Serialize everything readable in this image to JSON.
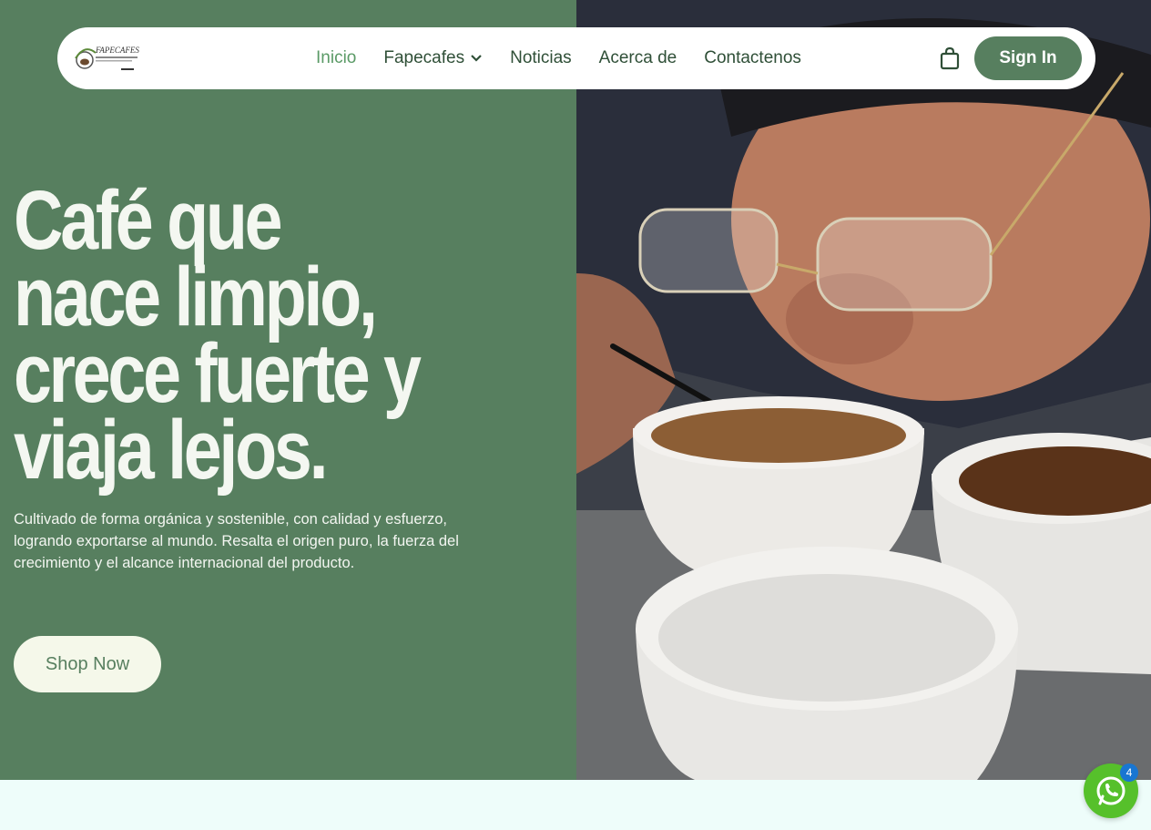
{
  "nav": {
    "items": [
      {
        "label": "Inicio",
        "active": true
      },
      {
        "label": "Fapecafes",
        "dropdown": true
      },
      {
        "label": "Noticias"
      },
      {
        "label": "Acerca de"
      },
      {
        "label": "Contactenos"
      }
    ],
    "signin_label": "Sign In",
    "cart_icon": "shopping-bag-icon",
    "logo_text": "FAPECAFES"
  },
  "hero": {
    "headline": "Café que nace limpio, crece fuerte y viaja lejos.",
    "subtitle": "Cultivado de forma orgánica y sostenible, con calidad y esfuerzo, logrando exportarse al mundo. Resalta el origen puro, la fuerza del crecimiento y el alcance internacional del producto.",
    "cta_label": "Shop Now"
  },
  "chat_widget": {
    "icon": "whatsapp-icon",
    "badge_count": "4"
  },
  "colors": {
    "brand_green": "#577f5f",
    "active_link": "#5a9a66",
    "cta_bg": "#f5f8ea",
    "whatsapp": "#56c02b",
    "badge": "#1976d2"
  }
}
